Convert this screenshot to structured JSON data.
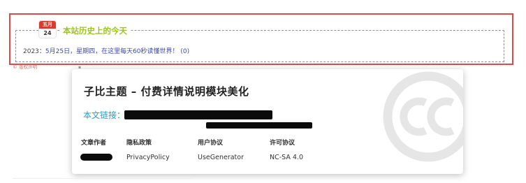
{
  "today_in_history": {
    "calendar": {
      "month": "五月",
      "day": "24"
    },
    "title": "本站历史上的今天",
    "entry": {
      "year": "2023：",
      "text": "5月25日，星期四，在这里每天60秒读懂世界！",
      "count": "(0)"
    }
  },
  "copyright_note": {
    "icon": "©",
    "text": "版权声明",
    "dot": "▪"
  },
  "card": {
    "title": "子比主题 – 付费详情说明模块美化",
    "link_label": "本文链接：",
    "meta": [
      {
        "head": "文章作者",
        "value": ""
      },
      {
        "head": "隐私政策",
        "value": "PrivacyPolicy"
      },
      {
        "head": "用户协议",
        "value": "UseGenerator"
      },
      {
        "head": "许可协议",
        "value": "NC-SA 4.0"
      }
    ],
    "cc_logo_icon": "creative-commons-icon"
  },
  "colors": {
    "frame_red": "#d94a4a",
    "title_green": "#9cc41d",
    "link_blue": "#1e9fd6",
    "calendar_red": "#d53d2f"
  }
}
